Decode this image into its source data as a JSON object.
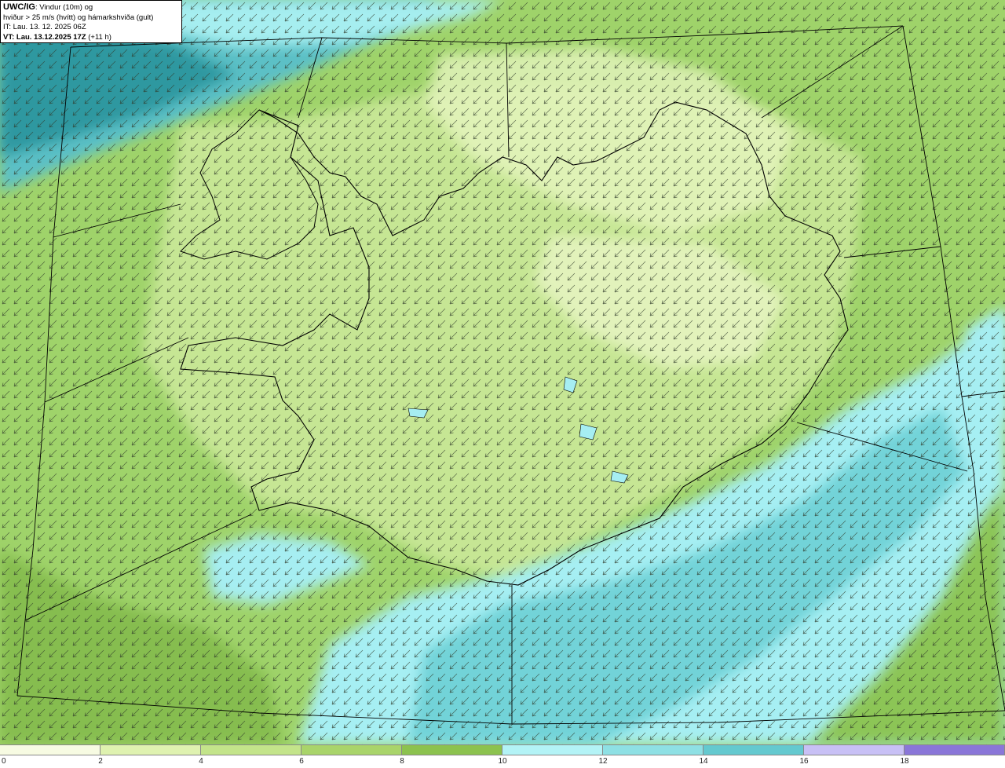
{
  "header": {
    "model": "UWC/IG",
    "title_rest": ": Vindur (10m) og",
    "subtitle": "hviður > 25 m/s (hvítt) og hámarkshviða (gult)",
    "init_time": "IT: Lau. 13. 12. 2025 06Z",
    "valid_prefix": "VT: Lau. 13.12.2025 17Z",
    "valid_offset": "(+11 h)"
  },
  "legend": {
    "ticks": [
      "0",
      "2",
      "4",
      "6",
      "8",
      "10",
      "12",
      "14",
      "16",
      "18"
    ],
    "colors": [
      "#f7fbe2",
      "#dff2b0",
      "#c3e48a",
      "#a9d46a",
      "#8cc24e",
      "#b3f3f6",
      "#8ee0e4",
      "#64c9cf",
      "#3aa7ad",
      "#1f8b92",
      "#c8c0f5",
      "#a896ea",
      "#8a76d8"
    ]
  },
  "map": {
    "land_color": "#b9de7d",
    "sea_color_light": "#9fe6ec",
    "sea_color_dark": "#2e9aa3",
    "coast_color": "#000000",
    "arrow_color": "#2b2b2b",
    "wind_direction": "from north-east, toward south-west"
  }
}
